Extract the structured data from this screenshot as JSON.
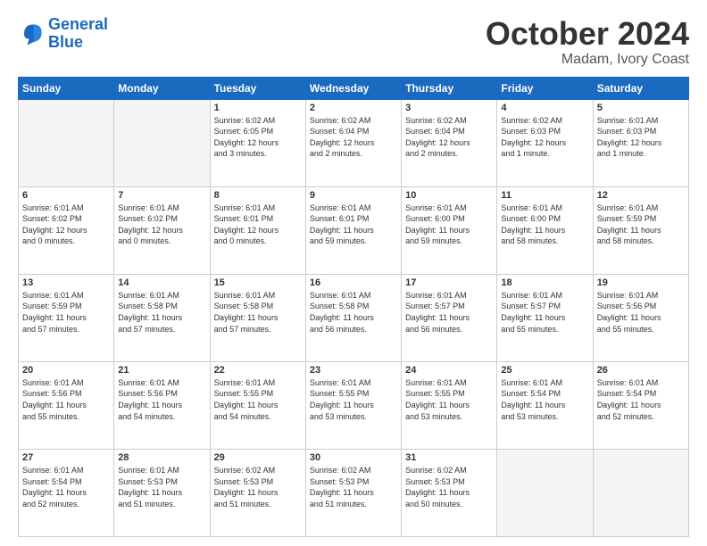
{
  "header": {
    "logo_line1": "General",
    "logo_line2": "Blue",
    "month": "October 2024",
    "location": "Madam, Ivory Coast"
  },
  "weekdays": [
    "Sunday",
    "Monday",
    "Tuesday",
    "Wednesday",
    "Thursday",
    "Friday",
    "Saturday"
  ],
  "rows": [
    [
      {
        "day": "",
        "content": ""
      },
      {
        "day": "",
        "content": ""
      },
      {
        "day": "1",
        "content": "Sunrise: 6:02 AM\nSunset: 6:05 PM\nDaylight: 12 hours\nand 3 minutes."
      },
      {
        "day": "2",
        "content": "Sunrise: 6:02 AM\nSunset: 6:04 PM\nDaylight: 12 hours\nand 2 minutes."
      },
      {
        "day": "3",
        "content": "Sunrise: 6:02 AM\nSunset: 6:04 PM\nDaylight: 12 hours\nand 2 minutes."
      },
      {
        "day": "4",
        "content": "Sunrise: 6:02 AM\nSunset: 6:03 PM\nDaylight: 12 hours\nand 1 minute."
      },
      {
        "day": "5",
        "content": "Sunrise: 6:01 AM\nSunset: 6:03 PM\nDaylight: 12 hours\nand 1 minute."
      }
    ],
    [
      {
        "day": "6",
        "content": "Sunrise: 6:01 AM\nSunset: 6:02 PM\nDaylight: 12 hours\nand 0 minutes."
      },
      {
        "day": "7",
        "content": "Sunrise: 6:01 AM\nSunset: 6:02 PM\nDaylight: 12 hours\nand 0 minutes."
      },
      {
        "day": "8",
        "content": "Sunrise: 6:01 AM\nSunset: 6:01 PM\nDaylight: 12 hours\nand 0 minutes."
      },
      {
        "day": "9",
        "content": "Sunrise: 6:01 AM\nSunset: 6:01 PM\nDaylight: 11 hours\nand 59 minutes."
      },
      {
        "day": "10",
        "content": "Sunrise: 6:01 AM\nSunset: 6:00 PM\nDaylight: 11 hours\nand 59 minutes."
      },
      {
        "day": "11",
        "content": "Sunrise: 6:01 AM\nSunset: 6:00 PM\nDaylight: 11 hours\nand 58 minutes."
      },
      {
        "day": "12",
        "content": "Sunrise: 6:01 AM\nSunset: 5:59 PM\nDaylight: 11 hours\nand 58 minutes."
      }
    ],
    [
      {
        "day": "13",
        "content": "Sunrise: 6:01 AM\nSunset: 5:59 PM\nDaylight: 11 hours\nand 57 minutes."
      },
      {
        "day": "14",
        "content": "Sunrise: 6:01 AM\nSunset: 5:58 PM\nDaylight: 11 hours\nand 57 minutes."
      },
      {
        "day": "15",
        "content": "Sunrise: 6:01 AM\nSunset: 5:58 PM\nDaylight: 11 hours\nand 57 minutes."
      },
      {
        "day": "16",
        "content": "Sunrise: 6:01 AM\nSunset: 5:58 PM\nDaylight: 11 hours\nand 56 minutes."
      },
      {
        "day": "17",
        "content": "Sunrise: 6:01 AM\nSunset: 5:57 PM\nDaylight: 11 hours\nand 56 minutes."
      },
      {
        "day": "18",
        "content": "Sunrise: 6:01 AM\nSunset: 5:57 PM\nDaylight: 11 hours\nand 55 minutes."
      },
      {
        "day": "19",
        "content": "Sunrise: 6:01 AM\nSunset: 5:56 PM\nDaylight: 11 hours\nand 55 minutes."
      }
    ],
    [
      {
        "day": "20",
        "content": "Sunrise: 6:01 AM\nSunset: 5:56 PM\nDaylight: 11 hours\nand 55 minutes."
      },
      {
        "day": "21",
        "content": "Sunrise: 6:01 AM\nSunset: 5:56 PM\nDaylight: 11 hours\nand 54 minutes."
      },
      {
        "day": "22",
        "content": "Sunrise: 6:01 AM\nSunset: 5:55 PM\nDaylight: 11 hours\nand 54 minutes."
      },
      {
        "day": "23",
        "content": "Sunrise: 6:01 AM\nSunset: 5:55 PM\nDaylight: 11 hours\nand 53 minutes."
      },
      {
        "day": "24",
        "content": "Sunrise: 6:01 AM\nSunset: 5:55 PM\nDaylight: 11 hours\nand 53 minutes."
      },
      {
        "day": "25",
        "content": "Sunrise: 6:01 AM\nSunset: 5:54 PM\nDaylight: 11 hours\nand 53 minutes."
      },
      {
        "day": "26",
        "content": "Sunrise: 6:01 AM\nSunset: 5:54 PM\nDaylight: 11 hours\nand 52 minutes."
      }
    ],
    [
      {
        "day": "27",
        "content": "Sunrise: 6:01 AM\nSunset: 5:54 PM\nDaylight: 11 hours\nand 52 minutes."
      },
      {
        "day": "28",
        "content": "Sunrise: 6:01 AM\nSunset: 5:53 PM\nDaylight: 11 hours\nand 51 minutes."
      },
      {
        "day": "29",
        "content": "Sunrise: 6:02 AM\nSunset: 5:53 PM\nDaylight: 11 hours\nand 51 minutes."
      },
      {
        "day": "30",
        "content": "Sunrise: 6:02 AM\nSunset: 5:53 PM\nDaylight: 11 hours\nand 51 minutes."
      },
      {
        "day": "31",
        "content": "Sunrise: 6:02 AM\nSunset: 5:53 PM\nDaylight: 11 hours\nand 50 minutes."
      },
      {
        "day": "",
        "content": ""
      },
      {
        "day": "",
        "content": ""
      }
    ]
  ]
}
